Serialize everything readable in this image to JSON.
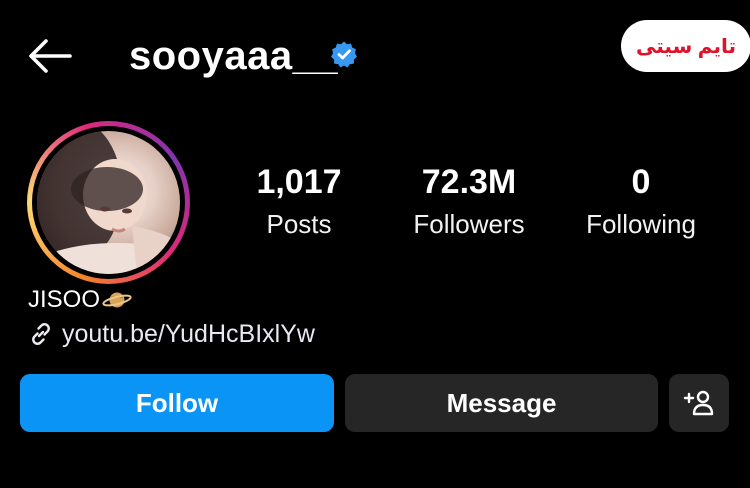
{
  "header": {
    "username": "sooyaaa__",
    "back_icon": "arrow-left-icon",
    "verified_icon": "verified-badge-icon",
    "verified_color": "#3897f0"
  },
  "watermark": {
    "text": "تایم سیتی"
  },
  "profile": {
    "avatar_ring_colors": [
      "#f58529",
      "#dd2a7b",
      "#8134af"
    ],
    "stats": [
      {
        "value": "1,017",
        "label": "Posts"
      },
      {
        "value": "72.3M",
        "label": "Followers"
      },
      {
        "value": "0",
        "label": "Following"
      }
    ],
    "name": "JISOO",
    "name_emoji_icon": "ringed-planet-icon",
    "link_icon": "link-icon",
    "link_text": "youtu.be/YudHcBIxlYw"
  },
  "actions": {
    "follow_label": "Follow",
    "message_label": "Message",
    "add_user_icon": "add-user-icon",
    "follow_color": "#0a95f6",
    "secondary_color": "#262626"
  }
}
